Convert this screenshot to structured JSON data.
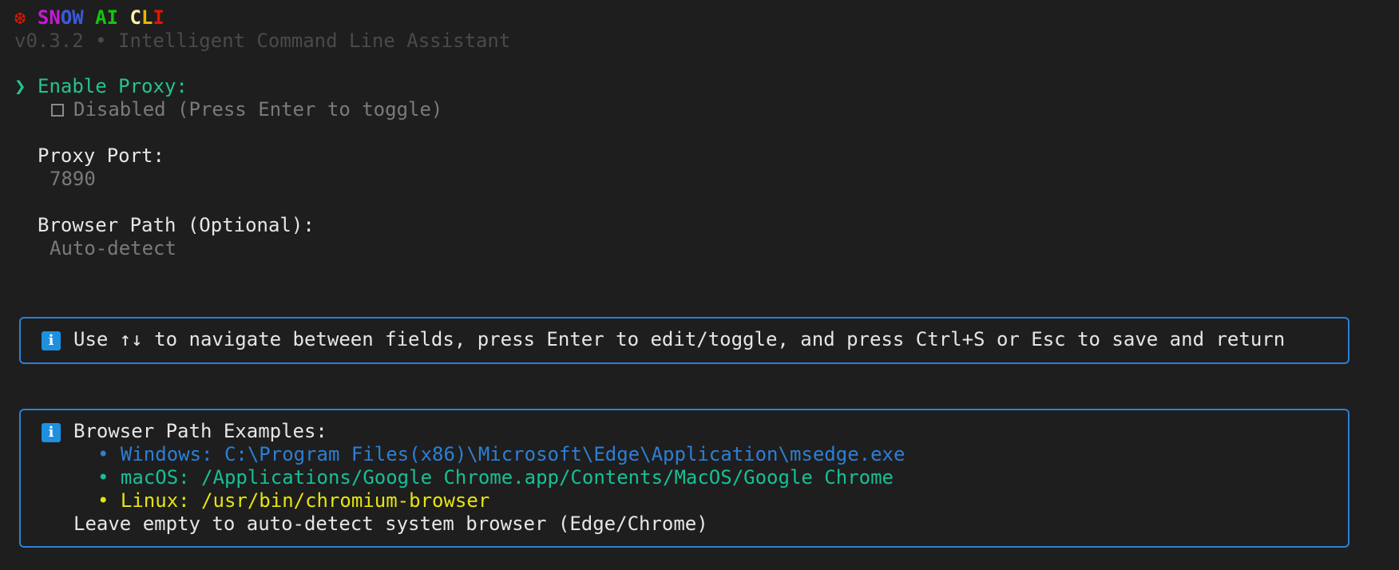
{
  "header": {
    "icon": "❆",
    "title_parts": [
      " ",
      "S",
      "N",
      "O",
      "W",
      " AI ",
      "C",
      "L",
      "I"
    ],
    "subtitle": "v0.3.2 • Intelligent Command Line Assistant"
  },
  "form": {
    "cursor": "❯",
    "fields": [
      {
        "label": "Enable Proxy:",
        "value": "Disabled (Press Enter to toggle)",
        "checked": false,
        "active": true
      },
      {
        "label": "Proxy Port:",
        "value": "7890"
      },
      {
        "label": "Browser Path (Optional):",
        "value": "Auto-detect"
      }
    ]
  },
  "help_box": {
    "icon": "info-icon",
    "text": "Use ↑↓ to navigate between fields, press Enter to edit/toggle, and press Ctrl+S or Esc to save and return"
  },
  "examples_box": {
    "icon": "info-icon",
    "title": "Browser Path Examples:",
    "examples": [
      "• Windows: C:\\Program Files(x86)\\Microsoft\\Edge\\Application\\msedge.exe",
      "• macOS: /Applications/Google Chrome.app/Contents/MacOS/Google Chrome",
      "• Linux: /usr/bin/chromium-browser"
    ],
    "note": "Leave empty to auto-detect system browser (Edge/Chrome)"
  },
  "colors": {
    "background": "#1e1e1e",
    "accent_green": "#23c58b",
    "box_border": "#2c7fd6",
    "windows": "#2c7fd6",
    "macos": "#16c095",
    "linux": "#e5e510"
  }
}
